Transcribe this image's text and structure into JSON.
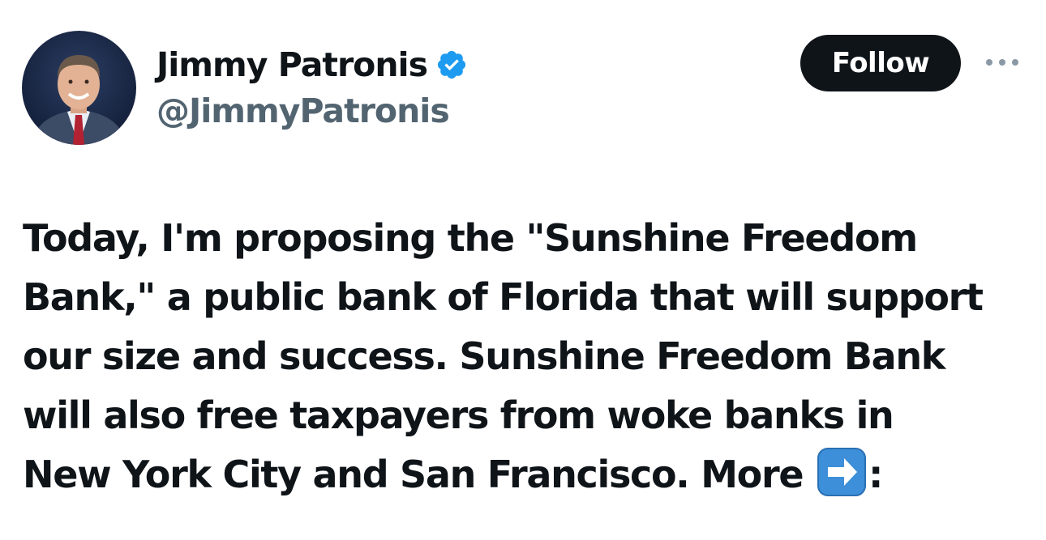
{
  "author": {
    "display_name": "Jimmy Patronis",
    "handle": "@JimmyPatronis",
    "verified": true,
    "verified_badge_color": "#1d9bf0"
  },
  "actions": {
    "follow_label": "Follow",
    "more_icon": "more-horizontal-icon"
  },
  "tweet": {
    "lines": [
      "Today, I'm proposing the \"Sunshine Freedom",
      "Bank,\" a public bank of Florida that will support",
      "our size and success. Sunshine Freedom Bank",
      "will also free taxpayers from woke banks in",
      "New York City and San Francisco. More"
    ],
    "trailing_emoji": "right-arrow-emoji",
    "trailing_text": ":"
  },
  "colors": {
    "text_primary": "#0f1419",
    "text_secondary": "#536471",
    "follow_bg": "#0f1419",
    "follow_text": "#ffffff",
    "verified": "#1d9bf0",
    "arrow_emoji": "#3d8fd9"
  }
}
